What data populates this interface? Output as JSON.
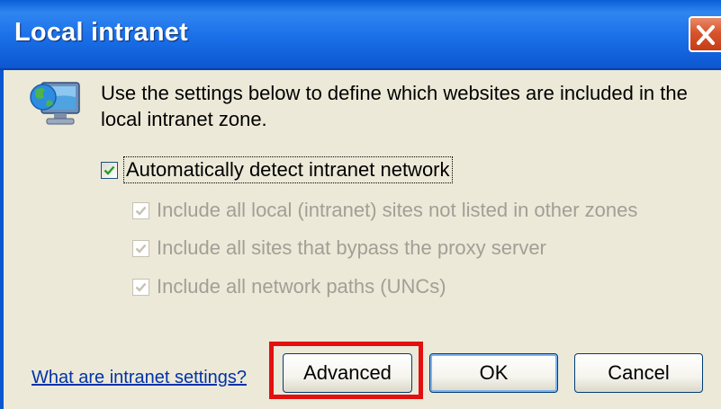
{
  "window": {
    "title": "Local intranet",
    "close_icon": "close-icon"
  },
  "intro": {
    "icon": "computer-globe-icon",
    "text": "Use the settings below to define which websites are included in the local intranet zone."
  },
  "options": {
    "auto_detect": {
      "label": "Automatically detect intranet network",
      "checked": true,
      "enabled": true
    },
    "local_sites": {
      "label": "Include all local (intranet) sites not listed in other zones",
      "checked": true,
      "enabled": false
    },
    "bypass_proxy": {
      "label": "Include all sites that bypass the proxy server",
      "checked": true,
      "enabled": false
    },
    "network_paths": {
      "label": "Include all network paths (UNCs)",
      "checked": true,
      "enabled": false
    }
  },
  "footer": {
    "help_link": "What are intranet settings?",
    "advanced_label": "Advanced",
    "ok_label": "OK",
    "cancel_label": "Cancel"
  },
  "colors": {
    "titlebar": "#0b57d0",
    "dialog_background": "#ece9d8",
    "highlight_box": "#e41010",
    "link": "#0033aa",
    "disabled_text": "#a19f96"
  }
}
